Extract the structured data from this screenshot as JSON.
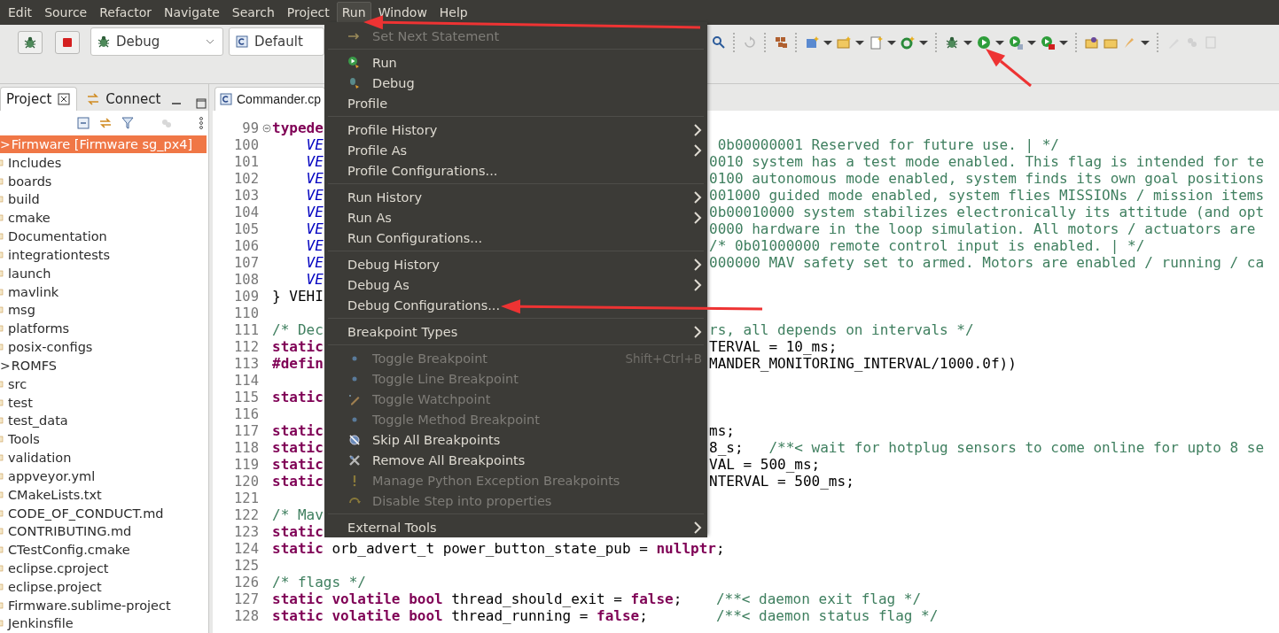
{
  "menubar": [
    {
      "label": "Edit",
      "selected": false
    },
    {
      "label": "Source",
      "selected": false
    },
    {
      "label": "Refactor",
      "selected": false
    },
    {
      "label": "Navigate",
      "selected": false
    },
    {
      "label": "Search",
      "selected": false
    },
    {
      "label": "Project",
      "selected": false
    },
    {
      "label": "Run",
      "selected": true
    },
    {
      "label": "Window",
      "selected": false
    },
    {
      "label": "Help",
      "selected": false
    }
  ],
  "toolbar": {
    "launch_mode": "Debug",
    "launch_target": "Default"
  },
  "project_panel": {
    "tabs": [
      {
        "label": "Project",
        "selected": true
      },
      {
        "label": "Connect",
        "selected": false
      }
    ],
    "tree": [
      {
        "label": "Firmware [Firmware sg_px4]",
        "caret": ">",
        "selected": true,
        "children": [
          {
            "label": "Includes",
            "selected": false
          },
          {
            "label": "boards",
            "selected": false
          },
          {
            "label": "build",
            "selected": false
          },
          {
            "label": "cmake",
            "selected": false
          },
          {
            "label": "Documentation",
            "selected": false
          },
          {
            "label": "integrationtests",
            "selected": false
          },
          {
            "label": "launch",
            "selected": false
          },
          {
            "label": "mavlink",
            "selected": false
          },
          {
            "label": "msg",
            "selected": false
          },
          {
            "label": "platforms",
            "selected": false
          },
          {
            "label": "posix-configs",
            "selected": false
          },
          {
            "label": "ROMFS",
            "caret": ">",
            "selected": false
          },
          {
            "label": "src",
            "selected": false
          },
          {
            "label": "test",
            "selected": false
          },
          {
            "label": "test_data",
            "selected": false
          },
          {
            "label": "Tools",
            "selected": false
          },
          {
            "label": "validation",
            "selected": false
          },
          {
            "label": "appveyor.yml",
            "selected": false
          },
          {
            "label": "CMakeLists.txt",
            "selected": false
          },
          {
            "label": "CODE_OF_CONDUCT.md",
            "selected": false
          },
          {
            "label": "CONTRIBUTING.md",
            "selected": false
          },
          {
            "label": "CTestConfig.cmake",
            "selected": false
          },
          {
            "label": "eclipse.cproject",
            "selected": false
          },
          {
            "label": "eclipse.project",
            "selected": false
          },
          {
            "label": "Firmware.sublime-project",
            "selected": false
          },
          {
            "label": "Jenkinsfile",
            "selected": false
          }
        ]
      }
    ]
  },
  "editor": {
    "tab": "Commander.cp",
    "lines": [
      {
        "number": "99",
        "left": [
          {
            "text": "typede",
            "kind": "keyword"
          }
        ]
      },
      {
        "number": "100",
        "left": [
          {
            "text": "    VE",
            "kind": "enum"
          }
        ],
        "right": [
          {
            "text": " 0b00000001 Reserved for future use. | */",
            "kind": "comment"
          }
        ]
      },
      {
        "number": "101",
        "left": [
          {
            "text": "    VE",
            "kind": "enum"
          }
        ],
        "right": [
          {
            "text": "0010 system has a test mode enabled. This flag is intended for te",
            "kind": "comment"
          }
        ]
      },
      {
        "number": "102",
        "left": [
          {
            "text": "    VE",
            "kind": "enum"
          }
        ],
        "right": [
          {
            "text": "0100 autonomous mode enabled, system finds its own goal positions",
            "kind": "comment"
          }
        ]
      },
      {
        "number": "103",
        "left": [
          {
            "text": "    VE",
            "kind": "enum"
          }
        ],
        "right": [
          {
            "text": "001000 guided mode enabled, system flies MISSIONs / mission items",
            "kind": "comment"
          }
        ]
      },
      {
        "number": "104",
        "left": [
          {
            "text": "    VE",
            "kind": "enum"
          }
        ],
        "right": [
          {
            "text": "0b00010000 system stabilizes electronically its attitude (and opt",
            "kind": "comment"
          }
        ]
      },
      {
        "number": "105",
        "left": [
          {
            "text": "    VE",
            "kind": "enum"
          }
        ],
        "right": [
          {
            "text": "0000 hardware in the loop simulation. All motors / actuators are",
            "kind": "comment"
          }
        ]
      },
      {
        "number": "106",
        "left": [
          {
            "text": "    VE",
            "kind": "enum"
          }
        ],
        "right": [
          {
            "text": "/* 0b01000000 remote control input is enabled. | */",
            "kind": "comment"
          }
        ]
      },
      {
        "number": "107",
        "left": [
          {
            "text": "    VE",
            "kind": "enum"
          }
        ],
        "right": [
          {
            "text": "000000 MAV safety set to armed. Motors are enabled / running / ca",
            "kind": "comment"
          }
        ]
      },
      {
        "number": "108",
        "left": [
          {
            "text": "    VE",
            "kind": "enum"
          }
        ]
      },
      {
        "number": "109",
        "left": [
          {
            "text": "} VEHI",
            "kind": "plain"
          }
        ]
      },
      {
        "number": "110"
      },
      {
        "number": "111",
        "left": [
          {
            "text": "/* Dec",
            "kind": "comment"
          }
        ],
        "right": [
          {
            "text": "rs, all depends on intervals */",
            "kind": "comment"
          }
        ]
      },
      {
        "number": "112",
        "left": [
          {
            "text": "static",
            "kind": "keyword"
          }
        ],
        "right": [
          {
            "text": "TERVAL = 10_ms;",
            "kind": "plain"
          }
        ]
      },
      {
        "number": "113",
        "left": [
          {
            "text": "#defin",
            "kind": "keyword"
          }
        ],
        "right": [
          {
            "text": "MANDER_MONITORING_INTERVAL/1000.0f))",
            "kind": "plain"
          }
        ]
      },
      {
        "number": "114"
      },
      {
        "number": "115",
        "left": [
          {
            "text": "static",
            "kind": "keyword"
          }
        ]
      },
      {
        "number": "116"
      },
      {
        "number": "117",
        "left": [
          {
            "text": "static",
            "kind": "keyword"
          }
        ],
        "right": [
          {
            "text": "ms;",
            "kind": "plain"
          }
        ]
      },
      {
        "number": "118",
        "left": [
          {
            "text": "static",
            "kind": "keyword"
          }
        ],
        "right": [
          {
            "text": "8_s;",
            "kind": "plain"
          },
          {
            "text": "   /**< wait for hotplug sensors to come online for upto 8 se",
            "kind": "comment"
          }
        ]
      },
      {
        "number": "119",
        "left": [
          {
            "text": "static",
            "kind": "keyword"
          }
        ],
        "right": [
          {
            "text": "VAL = 500_ms;",
            "kind": "plain"
          }
        ]
      },
      {
        "number": "120",
        "left": [
          {
            "text": "static",
            "kind": "keyword"
          }
        ],
        "right": [
          {
            "text": "NTERVAL = 500_ms;",
            "kind": "plain"
          }
        ]
      },
      {
        "number": "121"
      },
      {
        "number": "122",
        "left": [
          {
            "text": "/* Mav",
            "kind": "comment"
          }
        ]
      },
      {
        "number": "123",
        "left": [
          {
            "text": "static",
            "kind": "keyword"
          }
        ]
      },
      {
        "number": "124",
        "left": [
          {
            "text": "static",
            "kind": "keyword"
          },
          {
            "text": " orb_advert_t power_button_state_pub = ",
            "kind": "plain"
          },
          {
            "text": "nullptr",
            "kind": "keyword"
          },
          {
            "text": ";",
            "kind": "plain"
          }
        ]
      },
      {
        "number": "125"
      },
      {
        "number": "126",
        "left": [
          {
            "text": "/* flags */",
            "kind": "comment"
          }
        ]
      },
      {
        "number": "127",
        "left": [
          {
            "text": "static volatile bool",
            "kind": "keyword"
          },
          {
            "text": " thread_should_exit = ",
            "kind": "plain"
          },
          {
            "text": "false",
            "kind": "keyword"
          },
          {
            "text": ";",
            "kind": "plain"
          },
          {
            "text": "    /**< daemon exit flag */",
            "kind": "comment"
          }
        ]
      },
      {
        "number": "128",
        "left": [
          {
            "text": "static volatile bool",
            "kind": "keyword"
          },
          {
            "text": " thread_running = ",
            "kind": "plain"
          },
          {
            "text": "false",
            "kind": "keyword"
          },
          {
            "text": ";",
            "kind": "plain"
          },
          {
            "text": "        /**< daemon status flag */",
            "kind": "comment"
          }
        ]
      }
    ]
  },
  "run_menu": {
    "groups": [
      {
        "items": [
          {
            "label": "Set Next Statement",
            "disabled": true,
            "submenu": false
          }
        ]
      },
      {
        "items": [
          {
            "label": "Run",
            "disabled": false,
            "submenu": false
          },
          {
            "label": "Debug",
            "disabled": false,
            "submenu": false
          },
          {
            "label": "Profile",
            "disabled": false,
            "submenu": false
          }
        ]
      },
      {
        "items": [
          {
            "label": "Profile History",
            "disabled": false,
            "submenu": true
          },
          {
            "label": "Profile As",
            "disabled": false,
            "submenu": true
          },
          {
            "label": "Profile Configurations...",
            "disabled": false,
            "submenu": false
          }
        ]
      },
      {
        "items": [
          {
            "label": "Run History",
            "disabled": false,
            "submenu": true
          },
          {
            "label": "Run As",
            "disabled": false,
            "submenu": true
          },
          {
            "label": "Run Configurations...",
            "disabled": false,
            "submenu": false
          }
        ]
      },
      {
        "items": [
          {
            "label": "Debug History",
            "disabled": false,
            "submenu": true
          },
          {
            "label": "Debug As",
            "disabled": false,
            "submenu": true
          },
          {
            "label": "Debug Configurations...",
            "disabled": false,
            "submenu": false
          }
        ]
      },
      {
        "items": [
          {
            "label": "Breakpoint Types",
            "disabled": false,
            "submenu": true
          }
        ]
      },
      {
        "items": [
          {
            "label": "Toggle Breakpoint",
            "disabled": true,
            "submenu": false,
            "shortcut": "Shift+Ctrl+B"
          },
          {
            "label": "Toggle Line Breakpoint",
            "disabled": true,
            "submenu": false
          },
          {
            "label": "Toggle Watchpoint",
            "disabled": true,
            "submenu": false
          },
          {
            "label": "Toggle Method Breakpoint",
            "disabled": true,
            "submenu": false
          },
          {
            "label": "Skip All Breakpoints",
            "disabled": false,
            "submenu": false
          },
          {
            "label": "Remove All Breakpoints",
            "disabled": false,
            "submenu": false
          },
          {
            "label": "Manage Python Exception Breakpoints",
            "disabled": true,
            "submenu": false
          },
          {
            "label": "Disable Step into properties",
            "disabled": true,
            "submenu": false
          }
        ]
      },
      {
        "items": [
          {
            "label": "External Tools",
            "disabled": false,
            "submenu": true
          }
        ]
      }
    ]
  }
}
